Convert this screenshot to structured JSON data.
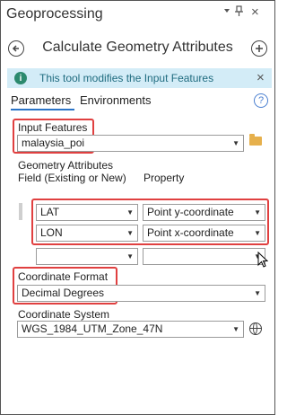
{
  "pane": {
    "title": "Geoprocessing",
    "pin_icon": "pin-icon",
    "menu_icon": "menu-icon",
    "close_icon": "close-icon"
  },
  "tool": {
    "back_icon": "back-arrow-icon",
    "title": "Calculate Geometry Attributes",
    "add_icon": "add-icon"
  },
  "info_bar": {
    "icon": "info-icon",
    "text": "This tool modifies the Input Features",
    "close": "×"
  },
  "tabs": {
    "parameters": "Parameters",
    "environments": "Environments",
    "help_icon": "?"
  },
  "input_features": {
    "label": "Input Features",
    "value": "malaysia_poi",
    "browse_icon": "folder-icon"
  },
  "geometry_attributes": {
    "label": "Geometry Attributes",
    "col_field": "Field (Existing or New)",
    "col_property": "Property",
    "rows": [
      {
        "field": "LAT",
        "property": "Point y-coordinate"
      },
      {
        "field": "LON",
        "property": "Point x-coordinate"
      },
      {
        "field": "",
        "property": ""
      }
    ]
  },
  "coordinate_format": {
    "label": "Coordinate Format",
    "value": "Decimal Degrees"
  },
  "coordinate_system": {
    "label": "Coordinate System",
    "value": "WGS_1984_UTM_Zone_47N",
    "globe_icon": "globe-icon"
  },
  "colors": {
    "highlight": "#e04040",
    "accent": "#2b74c7",
    "info_bg": "#d3ecf7"
  }
}
